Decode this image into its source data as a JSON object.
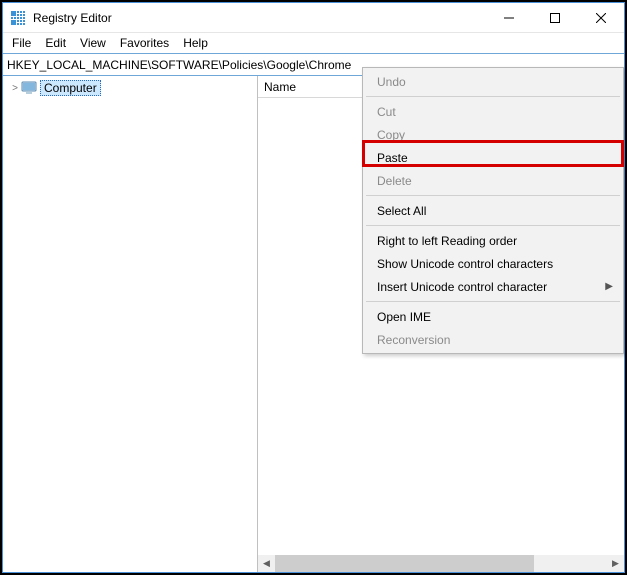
{
  "titlebar": {
    "title": "Registry Editor"
  },
  "menubar": {
    "items": [
      "File",
      "Edit",
      "View",
      "Favorites",
      "Help"
    ]
  },
  "addressbar": {
    "value": "HKEY_LOCAL_MACHINE\\SOFTWARE\\Policies\\Google\\Chrome"
  },
  "tree": {
    "root": {
      "label": "Computer",
      "expander": ">"
    }
  },
  "list": {
    "columns": [
      "Name"
    ]
  },
  "context_menu": {
    "groups": [
      [
        {
          "label": "Undo",
          "enabled": false
        }
      ],
      [
        {
          "label": "Cut",
          "enabled": false
        },
        {
          "label": "Copy",
          "enabled": false
        },
        {
          "label": "Paste",
          "enabled": true
        },
        {
          "label": "Delete",
          "enabled": false
        }
      ],
      [
        {
          "label": "Select All",
          "enabled": true
        }
      ],
      [
        {
          "label": "Right to left Reading order",
          "enabled": true
        },
        {
          "label": "Show Unicode control characters",
          "enabled": true
        },
        {
          "label": "Insert Unicode control character",
          "enabled": true,
          "submenu": true
        }
      ],
      [
        {
          "label": "Open IME",
          "enabled": true
        },
        {
          "label": "Reconversion",
          "enabled": false
        }
      ]
    ]
  }
}
